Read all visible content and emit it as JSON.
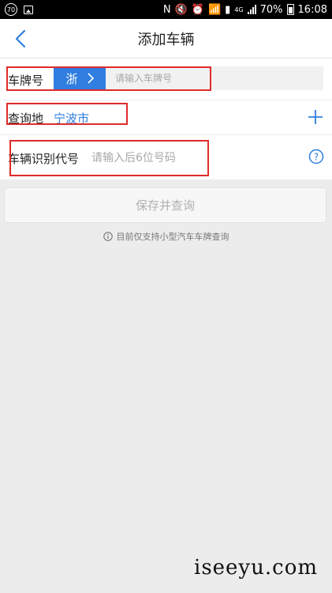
{
  "status_bar": {
    "badge": "70",
    "network": "4G",
    "battery": "70%",
    "time": "16:08"
  },
  "nav": {
    "title": "添加车辆",
    "back_icon": "chevron-left-icon"
  },
  "form": {
    "plate": {
      "label": "车牌号",
      "province": "浙",
      "placeholder": "请输入车牌号"
    },
    "city": {
      "label": "查询地",
      "value": "宁波市"
    },
    "vin": {
      "label": "车辆识别代号",
      "placeholder": "请输入后6位号码"
    }
  },
  "save_button": {
    "label": "保存并查询",
    "enabled": false
  },
  "notice": "目前仅支持小型汽车车牌查询",
  "watermark": "iseeyu.com",
  "colors": {
    "accent": "#2f7ee0",
    "annotation": "#e02a2a",
    "background": "#ececec"
  }
}
